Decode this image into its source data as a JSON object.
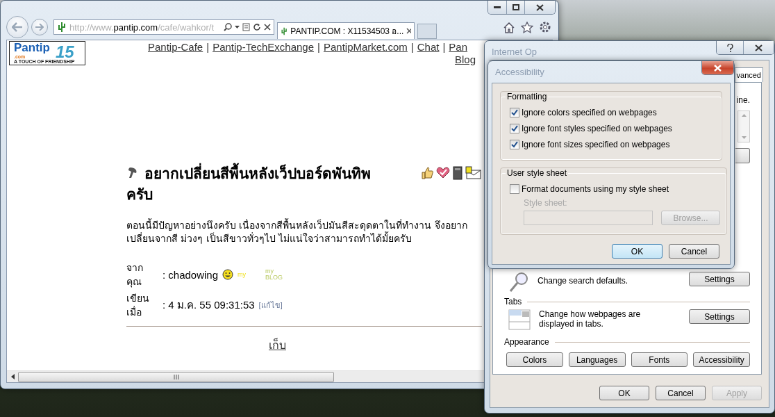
{
  "browser": {
    "address": {
      "prefix": "http://www.",
      "host": "pantip.com",
      "path": "/cafe/wahkor/t"
    },
    "tabs": [
      {
        "label": "PANTIP.COM : X11534503 อ...",
        "selected": true
      }
    ],
    "page": {
      "logo": {
        "name": "Pantip",
        "suffix": ".com",
        "number": "15",
        "tagline": "A TOUCH OF FRIENDSHIP"
      },
      "nav_links": [
        "Pantip-Cafe",
        "Pantip-TechExchange",
        "PantipMarket.com",
        "Chat",
        "Pan"
      ],
      "nav_separator": "|",
      "nav_links_line2": [
        "Blog"
      ],
      "post": {
        "title": "อยากเปลี่ยนสีพื้นหลังเว็ปบอร์ดพันทิพ ครับ",
        "body": "ตอนนี้มีปัญหาอย่างนึงครับ เนื่องจากสีพื้นหลังเว็ปมันสีสะดุดตาในที่ทำงาน จึงอยากเปลี่ยนจากสี ม่วงๆ เป็นสีขาวทั่วๆไป ไม่แน่ใจว่าสามารถทำได้มั้ยครับ",
        "meta": [
          {
            "kind": "author",
            "label": "จาก คุณ",
            "value": ": chadowing",
            "badges": [
              "my",
              "my BLOG"
            ]
          },
          {
            "kind": "date",
            "label": "เขียน เมื่อ",
            "value": ": 4 ม.ค. 55 09:31:53",
            "edit": "[แก้ไข]"
          }
        ],
        "actions": [
          "เก็บ"
        ]
      }
    }
  },
  "internet_options": {
    "title": "Internet Op",
    "tab_fragment": "vanced",
    "text_fragment": "ine.",
    "search": {
      "description": "Change search defaults.",
      "button": "Settings"
    },
    "tabs_section": {
      "heading": "Tabs",
      "description": "Change how webpages are displayed in tabs.",
      "button": "Settings"
    },
    "appearance": {
      "heading": "Appearance",
      "buttons": [
        "Colors",
        "Languages",
        "Fonts",
        "Accessibility"
      ]
    },
    "buttons": [
      {
        "label": "OK",
        "disabled": false
      },
      {
        "label": "Cancel",
        "disabled": false
      },
      {
        "label": "Apply",
        "disabled": true
      }
    ]
  },
  "accessibility": {
    "title": "Accessibility",
    "formatting": {
      "heading": "Formatting",
      "options": [
        {
          "label": "Ignore colors specified on webpages",
          "checked": true
        },
        {
          "label": "Ignore font styles specified on webpages",
          "checked": true
        },
        {
          "label": "Ignore font sizes specified on webpages",
          "checked": true
        }
      ]
    },
    "style_sheet": {
      "heading": "User style sheet",
      "option": {
        "label": "Format documents using my style sheet",
        "checked": false
      },
      "field_label": "Style sheet:",
      "browse": "Browse...",
      "disabled": true
    },
    "buttons": [
      {
        "label": "OK",
        "default": true
      },
      {
        "label": "Cancel",
        "default": false
      }
    ]
  }
}
